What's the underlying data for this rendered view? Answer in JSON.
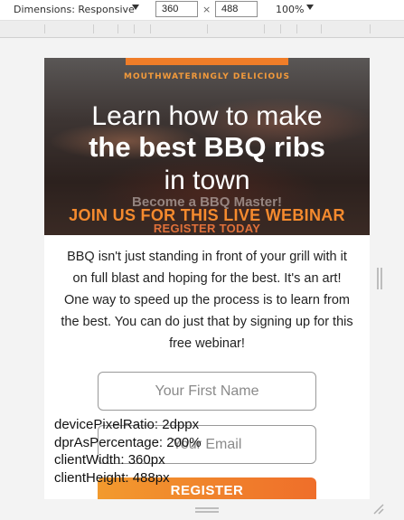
{
  "toolbar": {
    "device_label": "Dimensions: Responsive",
    "width_value": "360",
    "times_symbol": "×",
    "height_value": "488",
    "zoom_label": "100%"
  },
  "hero": {
    "eyebrow": "MOUTHWATERINGLY DELICIOUS",
    "line1": "Learn how to make",
    "line2": "the best BBQ ribs",
    "line3": "in town",
    "ghost": "Become a BBQ Master!",
    "cta1": "JOIN US FOR THIS LIVE WEBINAR",
    "cta2": "REGISTER TODAY"
  },
  "body": {
    "paragraph": "BBQ isn't just standing in front of your grill with it on full blast and hoping for the best. It's an art! One way to speed up the process is to learn from the best. You can do just that by signing up for this free webinar!"
  },
  "form": {
    "first_name_placeholder": "Your First Name",
    "email_placeholder": "Your Email",
    "register_label": "REGISTER"
  },
  "debug": {
    "dpr": "devicePixelRatio: 2dppx",
    "dpr_percent": "dprAsPercentage: 200%",
    "client_width": "clientWidth: 360px",
    "client_height": "clientHeight: 488px"
  },
  "colors": {
    "accent_orange": "#f07d28",
    "button_gradient_start": "#f29a2e",
    "button_gradient_end": "#ef6e2a"
  }
}
